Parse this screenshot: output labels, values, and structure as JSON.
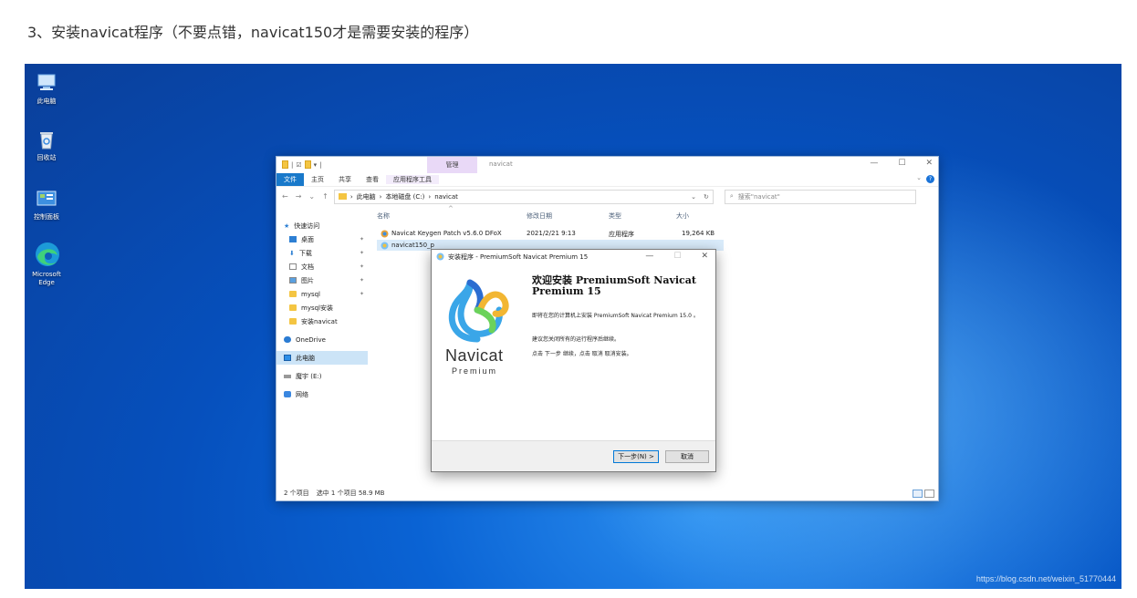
{
  "heading": "3、安装navicat程序（不要点错，navicat150才是需要安装的程序）",
  "desktop": {
    "icons": [
      {
        "label": "此电脑",
        "icon": "computer-icon"
      },
      {
        "label": "回收站",
        "icon": "recycle-bin-icon"
      },
      {
        "label": "控制面板",
        "icon": "control-panel-icon"
      },
      {
        "label": "Microsoft Edge",
        "icon": "edge-icon"
      }
    ],
    "watermark": "https://blog.csdn.net/weixin_51770444"
  },
  "explorer": {
    "manage_tab": "管理",
    "title": "navicat",
    "ribbon": {
      "file": "文件",
      "home": "主页",
      "share": "共享",
      "view": "查看",
      "app_tools": "应用程序工具"
    },
    "address": {
      "pc": "此电脑",
      "drive": "本地磁盘 (C:)",
      "folder": "navicat"
    },
    "search_placeholder": "搜索\"navicat\"",
    "nav": {
      "quick_access": "快速访问",
      "desktop": "桌面",
      "downloads": "下载",
      "documents": "文档",
      "pictures": "图片",
      "mysql": "mysql",
      "mysql_install": "mysql安装",
      "navicat_install": "安装navicat",
      "onedrive": "OneDrive",
      "this_pc": "此电脑",
      "drive_e": "魔宇 (E:)",
      "network": "网络"
    },
    "columns": {
      "name": "名称",
      "date": "修改日期",
      "type": "类型",
      "size": "大小"
    },
    "files": [
      {
        "name": "Navicat Keygen Patch v5.6.0 DFoX",
        "date": "2021/2/21 9:13",
        "type": "应用程序",
        "size": "19,264 KB"
      },
      {
        "name": "navicat150_p",
        "date": "",
        "type": "",
        "size": ""
      }
    ],
    "status": {
      "count": "2 个项目",
      "selected": "选中 1 个项目  58.9 MB"
    }
  },
  "installer": {
    "title": "安装程序 - PremiumSoft Navicat Premium 15",
    "brand": "Navicat",
    "brand_sub": "Premium",
    "heading": "欢迎安装 PremiumSoft Navicat Premium 15",
    "line1": "即将在您的计算机上安装 PremiumSoft Navicat Premium 15.0 。",
    "line2": "建议您关闭所有的运行程序后继续。",
    "line3": "点击 下一步 继续，点击 取消 取消安装。",
    "next_button": "下一步(N) >",
    "cancel_button": "取消"
  }
}
